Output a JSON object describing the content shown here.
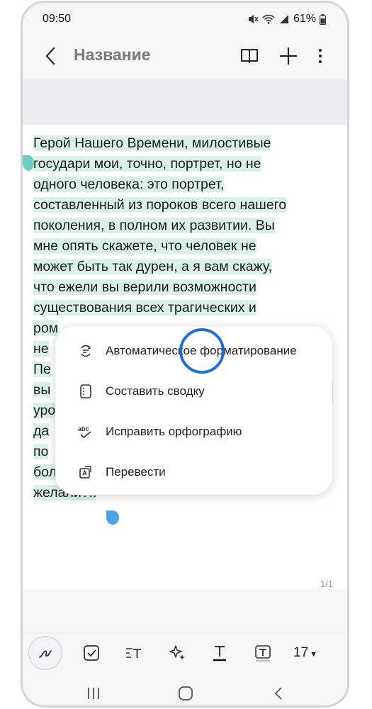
{
  "status": {
    "time": "09:50",
    "battery": "61%"
  },
  "header": {
    "title": "Название"
  },
  "note": {
    "lines": [
      "Герой Нашего Времени, милостивые",
      "государи мои, точно, портрет, но не",
      "одного человека: это портрет,",
      "составленный из пороков всего нашего",
      "поколения, в полном их развитии. Вы",
      "мне опять скажете, что человек не",
      "может быть так дурен, а я вам скажу,",
      "что ежели вы верили возможности",
      "существования всех трагических и",
      "ром",
      "не",
      "Пе",
      "вы",
      "уро",
      "да",
      "по",
      "бол",
      "желали?.."
    ],
    "page_number": "1/1"
  },
  "context_menu": {
    "items": [
      {
        "label": "Автоматическое форматирование",
        "icon": "auto-format-icon"
      },
      {
        "label": "Составить сводку",
        "icon": "summary-icon"
      },
      {
        "label": "Исправить орфографию",
        "icon": "spellcheck-icon"
      },
      {
        "label": "Перевести",
        "icon": "translate-icon"
      }
    ]
  },
  "toolbar": {
    "font_size": "17"
  },
  "colors": {
    "highlight": "#d9f1e8",
    "cursor_ring": "#1f6fd6",
    "handle_left": "#6ccfc0",
    "handle_right": "#4aa3e6"
  }
}
